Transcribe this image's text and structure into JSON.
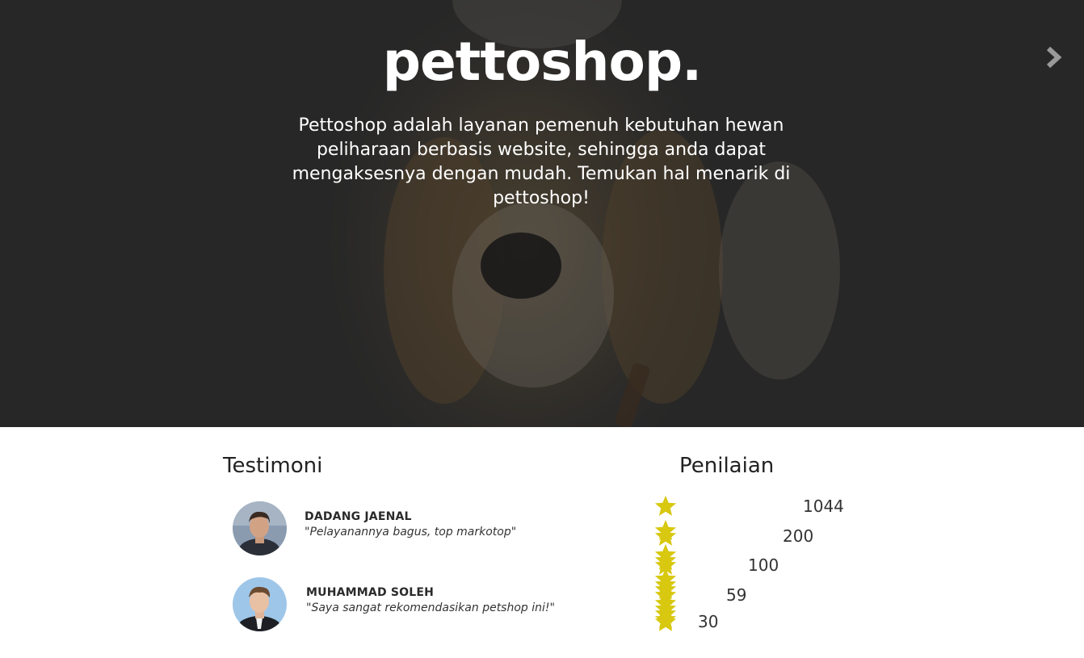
{
  "hero": {
    "brand": "pettoshop.",
    "description": "Pettoshop adalah layanan pemenuh kebutuhan hewan peliharaan berbasis website, sehingga anda dapat mengaksesnya dengan mudah. Temukan hal menarik di pettoshop!",
    "next_icon": "chevron-right-icon"
  },
  "testimoni": {
    "title": "Testimoni",
    "items": [
      {
        "name": "DADANG JAENAL",
        "quote": "\"Pelayanannya bagus, top markotop\""
      },
      {
        "name": "MUHAMMAD SOLEH",
        "quote": "\"Saya sangat rekomendasikan petshop ini!\""
      }
    ]
  },
  "penilaian": {
    "title": "Penilaian",
    "star_color": "#d8c80f",
    "rows": [
      {
        "stars": 5,
        "count": "1044"
      },
      {
        "stars": 4,
        "count": "200"
      },
      {
        "stars": 3,
        "count": "100"
      },
      {
        "stars": 2,
        "count": "59"
      },
      {
        "stars": 1,
        "count": "30"
      }
    ]
  }
}
